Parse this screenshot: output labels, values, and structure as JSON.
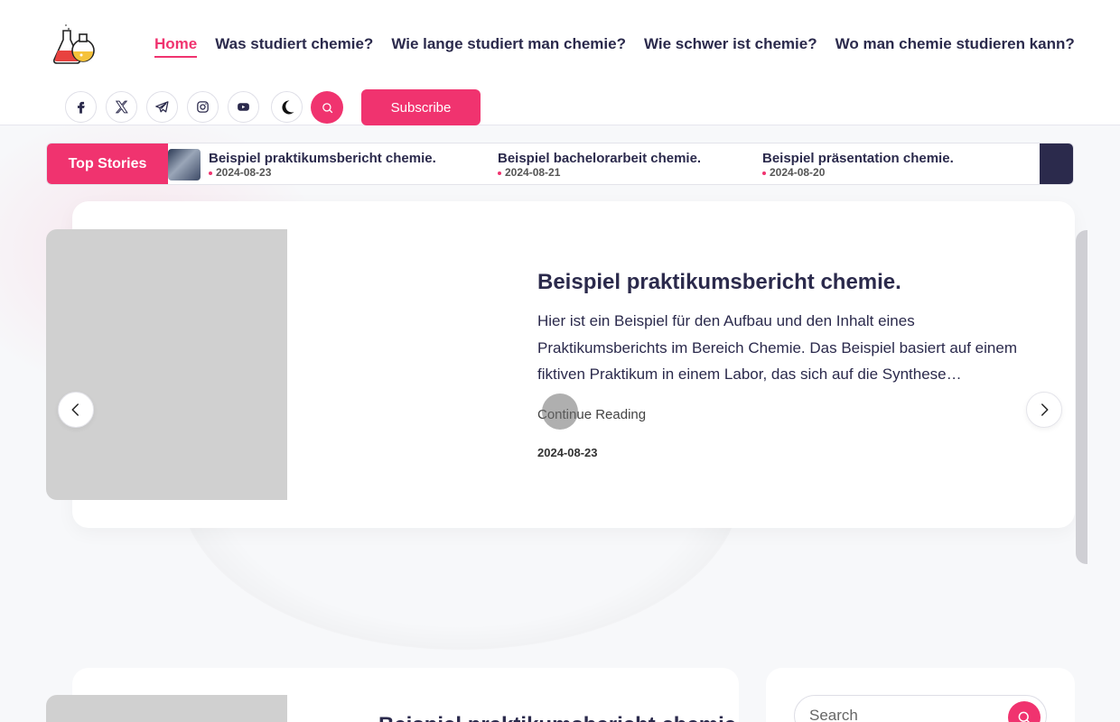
{
  "colors": {
    "accent": "#f0336f",
    "text": "#2b2a4c",
    "placeholder_image": "#d0d0d0"
  },
  "header": {
    "logo": "chemistry-flasks-logo",
    "nav": [
      {
        "label": "Home",
        "active": true
      },
      {
        "label": "Was studiert chemie?"
      },
      {
        "label": "Wie lange studiert man chemie?"
      },
      {
        "label": "Wie schwer ist chemie?"
      },
      {
        "label": "Wo man chemie studieren kann?"
      }
    ],
    "social": [
      "facebook-icon",
      "x-twitter-icon",
      "telegram-icon",
      "instagram-icon",
      "youtube-icon"
    ],
    "theme_toggle": "moon-icon",
    "search_icon": "search-icon",
    "subscribe_label": "Subscribe"
  },
  "ticker": {
    "label": "Top Stories",
    "items": [
      {
        "title": "Beispiel praktikumsbericht chemie.",
        "date": "2024-08-23"
      },
      {
        "title": "Beispiel bachelorarbeit chemie.",
        "date": "2024-08-21"
      },
      {
        "title": "Beispiel präsentation chemie.",
        "date": "2024-08-20"
      }
    ]
  },
  "slider": {
    "title": "Beispiel praktikumsbericht chemie.",
    "excerpt": "Hier ist ein Beispiel für den Aufbau und den Inhalt eines Praktikumsberichts im Bereich Chemie. Das Beispiel basiert auf einem fiktiven Praktikum in einem Labor, das sich auf die Synthese…",
    "continue_label": "Continue Reading",
    "date": "2024-08-23"
  },
  "posts": [
    {
      "title": "Beispiel praktikumsbericht chemie."
    }
  ],
  "sidebar": {
    "search_placeholder": "Search"
  }
}
